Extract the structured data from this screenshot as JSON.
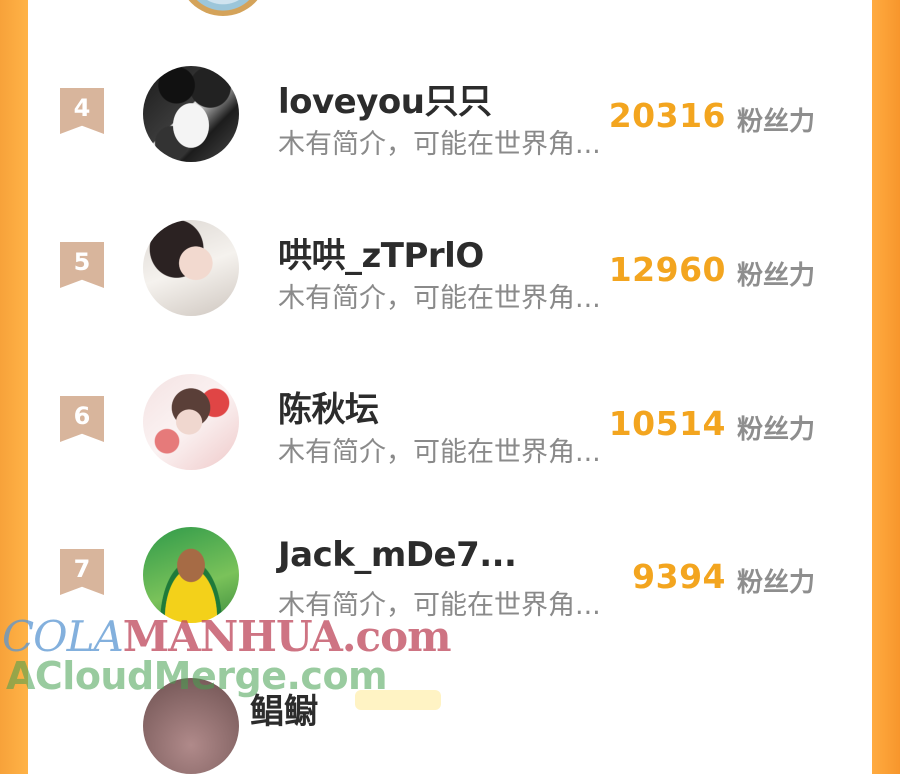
{
  "unit_label": "粉丝力",
  "default_bio": "木有简介，可能在世界角...",
  "rows": [
    {
      "rank": "4",
      "name": "loveyou只只",
      "bio": "木有简介，可能在世界角...",
      "score": "20316"
    },
    {
      "rank": "5",
      "name": "哄哄_zTPrlO",
      "bio": "木有简介，可能在世界角...",
      "score": "12960"
    },
    {
      "rank": "6",
      "name": "陈秋坛",
      "bio": "木有简介，可能在世界角...",
      "score": "10514"
    },
    {
      "rank": "7",
      "name": "Jack_mDe7...",
      "bio": "木有简介，可能在世界角...",
      "score": "9394"
    }
  ],
  "partial_row": {
    "name": "鲳鳚"
  },
  "watermark": {
    "line1_a": "COLA",
    "line1_b": "MANHUA.com",
    "line2": "ACloudMerge.com"
  },
  "colors": {
    "accent": "#f3a51f",
    "rank_badge": "#d8b59c",
    "side": "#ffab40"
  }
}
